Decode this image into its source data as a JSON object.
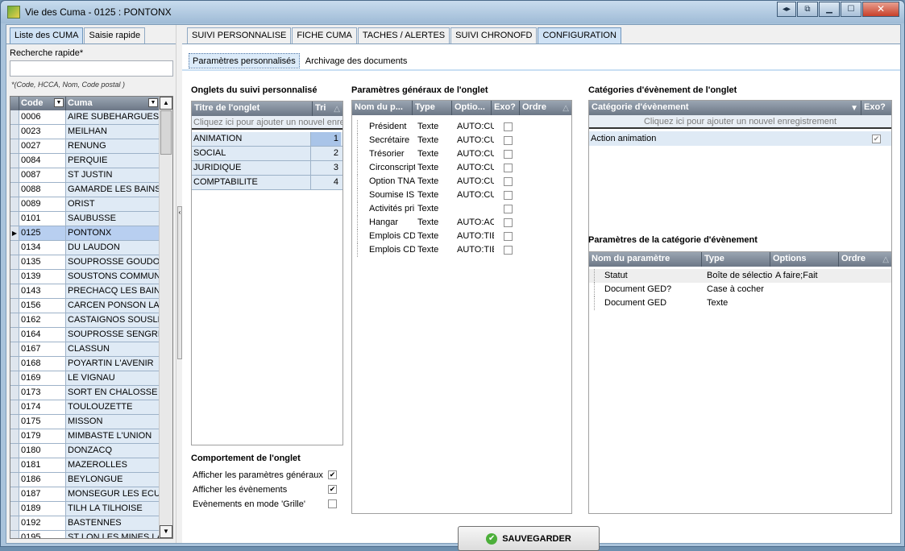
{
  "window": {
    "title": "Vie des Cuma - 0125 : PONTONX"
  },
  "left": {
    "tabs": [
      {
        "label": "Liste des CUMA"
      },
      {
        "label": "Saisie rapide"
      }
    ],
    "quick_search_label": "Recherche rapide*",
    "quick_search_value": "",
    "quick_search_hint": "*(Code, HCCA, Nom, Code postal )",
    "grid": {
      "headers": {
        "code": "Code",
        "name": "Cuma"
      },
      "selected_code": "0125",
      "rows": [
        {
          "code": "0006",
          "name": "AIRE SUBEHARGUES"
        },
        {
          "code": "0023",
          "name": "MEILHAN"
        },
        {
          "code": "0027",
          "name": "RENUNG"
        },
        {
          "code": "0084",
          "name": "PERQUIE"
        },
        {
          "code": "0087",
          "name": "ST JUSTIN"
        },
        {
          "code": "0088",
          "name": "GAMARDE LES BAINS"
        },
        {
          "code": "0089",
          "name": "ORIST"
        },
        {
          "code": "0101",
          "name": "SAUBUSSE"
        },
        {
          "code": "0125",
          "name": "PONTONX"
        },
        {
          "code": "0134",
          "name": "DU LAUDON"
        },
        {
          "code": "0135",
          "name": "SOUPROSSE GOUDOSS"
        },
        {
          "code": "0139",
          "name": "SOUSTONS COMMUNA"
        },
        {
          "code": "0143",
          "name": "PRECHACQ LES BAINS"
        },
        {
          "code": "0156",
          "name": "CARCEN PONSON LA M"
        },
        {
          "code": "0162",
          "name": "CASTAIGNOS SOUSLEN"
        },
        {
          "code": "0164",
          "name": "SOUPROSSE SENGRES"
        },
        {
          "code": "0167",
          "name": "CLASSUN"
        },
        {
          "code": "0168",
          "name": "POYARTIN L'AVENIR"
        },
        {
          "code": "0169",
          "name": "LE VIGNAU"
        },
        {
          "code": "0173",
          "name": "SORT EN CHALOSSE"
        },
        {
          "code": "0174",
          "name": "TOULOUZETTE"
        },
        {
          "code": "0175",
          "name": "MISSON"
        },
        {
          "code": "0179",
          "name": "MIMBASTE L'UNION"
        },
        {
          "code": "0180",
          "name": "DONZACQ"
        },
        {
          "code": "0181",
          "name": "MAZEROLLES"
        },
        {
          "code": "0186",
          "name": "BEYLONGUE"
        },
        {
          "code": "0187",
          "name": "MONSEGUR LES ECURE"
        },
        {
          "code": "0189",
          "name": "TILH LA TILHOISE"
        },
        {
          "code": "0192",
          "name": "BASTENNES"
        },
        {
          "code": "0195",
          "name": "ST LON LES MINES LA L"
        }
      ]
    }
  },
  "main_tabs": [
    {
      "label": "SUIVI PERSONNALISE"
    },
    {
      "label": "FICHE CUMA"
    },
    {
      "label": "TACHES / ALERTES"
    },
    {
      "label": "SUIVI CHRONOFD"
    },
    {
      "label": "CONFIGURATION"
    }
  ],
  "sub_tabs": [
    {
      "label": "Paramètres personnalisés"
    },
    {
      "label": "Archivage des documents"
    }
  ],
  "onglets": {
    "title": "Onglets du suivi personnalisé",
    "headers": {
      "title": "Titre de l'onglet",
      "order": "Tri"
    },
    "new_row": "Cliquez ici pour ajouter un nouvel enregistrement",
    "rows": [
      {
        "title": "ANIMATION",
        "order": "1"
      },
      {
        "title": "SOCIAL",
        "order": "2"
      },
      {
        "title": "JURIDIQUE",
        "order": "3"
      },
      {
        "title": "COMPTABILITE",
        "order": "4"
      }
    ]
  },
  "behaviour": {
    "title": "Comportement de l'onglet",
    "items": [
      {
        "label": "Afficher les paramètres généraux",
        "checked": "✔"
      },
      {
        "label": "Afficher les évènements",
        "checked": "✔"
      },
      {
        "label": "Evènements en mode 'Grille'",
        "checked": ""
      }
    ]
  },
  "general_params": {
    "title": "Paramètres généraux de l'onglet",
    "headers": {
      "name": "Nom du p...",
      "type": "Type",
      "options": "Optio...",
      "exo": "Exo?",
      "order": "Ordre"
    },
    "rows": [
      {
        "name": "Président",
        "type": "Texte",
        "options": "AUTO:CU"
      },
      {
        "name": "Secrétaire",
        "type": "Texte",
        "options": "AUTO:CU"
      },
      {
        "name": "Trésorier",
        "type": "Texte",
        "options": "AUTO:CU"
      },
      {
        "name": "Circonscripti",
        "type": "Texte",
        "options": "AUTO:CU"
      },
      {
        "name": "Option TNA",
        "type": "Texte",
        "options": "AUTO:CU"
      },
      {
        "name": "Soumise IS",
        "type": "Texte",
        "options": "AUTO:CU"
      },
      {
        "name": "Activités prir",
        "type": "Texte",
        "options": ""
      },
      {
        "name": "Hangar",
        "type": "Texte",
        "options": "AUTO:AC"
      },
      {
        "name": "Emplois CDI",
        "type": "Texte",
        "options": "AUTO:TIE"
      },
      {
        "name": "Emplois CDD",
        "type": "Texte",
        "options": "AUTO:TIE"
      }
    ]
  },
  "categories": {
    "title": "Catégories d'évènement de l'onglet",
    "headers": {
      "name": "Catégorie d'évènement",
      "exo": "Exo?"
    },
    "new_row": "Cliquez ici pour ajouter un nouvel enregistrement",
    "rows": [
      {
        "name": "Action animation",
        "exo": "✔"
      }
    ]
  },
  "category_params": {
    "title": "Paramètres de la catégorie d'évènement",
    "headers": {
      "name": "Nom du paramètre",
      "type": "Type",
      "options": "Options",
      "order": "Ordre"
    },
    "rows": [
      {
        "name": "Statut",
        "type": "Boîte de sélection",
        "options": "A faire;Fait"
      },
      {
        "name": "Document GED?",
        "type": "Case à cocher",
        "options": ""
      },
      {
        "name": "Document GED",
        "type": "Texte",
        "options": ""
      }
    ]
  },
  "save_button": {
    "label": "SAUVEGARDER"
  }
}
